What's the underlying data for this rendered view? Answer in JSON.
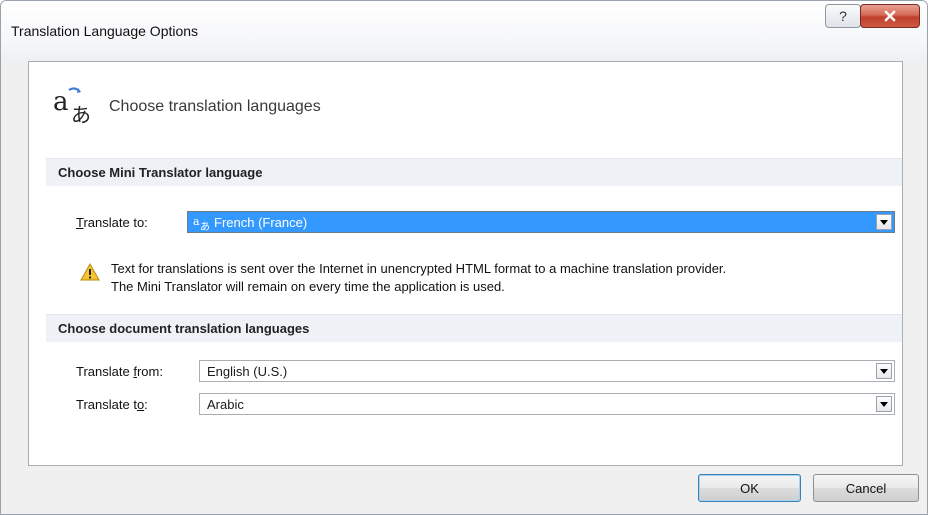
{
  "window": {
    "title": "Translation Language Options",
    "help_glyph": "?",
    "close_glyph": "X"
  },
  "header": {
    "title": "Choose translation languages",
    "icon": "translate-icon"
  },
  "mini_translator": {
    "section_title": "Choose Mini Translator language",
    "translate_to_label": "Translate to:",
    "translate_to_value": "French (France)",
    "warning_line1": "Text for translations is sent over the Internet in unencrypted HTML format to a machine translation provider.",
    "warning_line2": "The Mini Translator will remain on every time the application is used."
  },
  "document_translation": {
    "section_title": "Choose document translation languages",
    "from_label": "Translate from:",
    "from_value": "English (U.S.)",
    "to_label": "Translate to:",
    "to_value": "Arabic"
  },
  "buttons": {
    "ok": "OK",
    "cancel": "Cancel"
  },
  "colors": {
    "selection": "#3399ff",
    "close_button": "#c0402b",
    "section_bg": "#eef1f5"
  }
}
